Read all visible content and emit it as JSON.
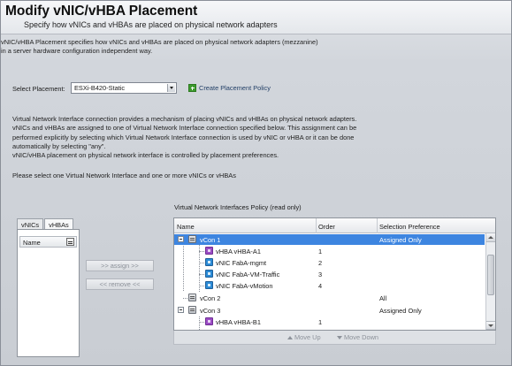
{
  "header": {
    "title": "Modify vNIC/vHBA Placement",
    "subtitle": "Specify how vNICs and vHBAs are placed on physical network adapters"
  },
  "intro": {
    "line1": "vNIC/vHBA Placement specifies how vNICs and vHBAs are placed on physical network adapters (mezzanine)",
    "line2": "in a server hardware configuration independent way."
  },
  "placement": {
    "label": "Select Placement:",
    "selected": "ESXi-B420-Static",
    "create_label": "Create Placement Policy"
  },
  "explanation": {
    "line1": "Virtual Network Interface connection provides a mechanism of placing vNICs and vHBAs on physical network adapters.",
    "line2": "vNICs and vHBAs are assigned to one of Virtual Network Interface connection specified below. This assignment can be",
    "line3": "performed explicitly by selecting which Virtual Network Interface connection is used by vNIC or vHBA or it can be done",
    "line4": "automatically by selecting \"any\".",
    "line5": "vNIC/vHBA placement on physical network interface is controlled by placement preferences.",
    "instruction": "Please select one Virtual Network Interface and one or more vNICs or vHBAs"
  },
  "left_panel": {
    "tabs": [
      {
        "label": "vNICs"
      },
      {
        "label": "vHBAs"
      }
    ],
    "column": "Name"
  },
  "buttons": {
    "assign": ">> assign >>",
    "remove": "<< remove <<"
  },
  "policy_table": {
    "label": "Virtual Network Interfaces Policy (read only)",
    "columns": [
      "Name",
      "Order",
      "Selection Preference"
    ],
    "rows": [
      {
        "name": "vCon 1",
        "order": "",
        "preference": "Assigned Only"
      },
      {
        "name": "vHBA vHBA-A1",
        "order": "1",
        "preference": ""
      },
      {
        "name": "vNIC FabA-mgmt",
        "order": "2",
        "preference": ""
      },
      {
        "name": "vNIC FabA-VM-Traffic",
        "order": "3",
        "preference": ""
      },
      {
        "name": "vNIC FabA-vMotion",
        "order": "4",
        "preference": ""
      },
      {
        "name": "vCon 2",
        "order": "",
        "preference": "All"
      },
      {
        "name": "vCon 3",
        "order": "",
        "preference": "Assigned Only"
      },
      {
        "name": "vHBA vHBA-B1",
        "order": "1",
        "preference": ""
      }
    ]
  },
  "actions": {
    "move_up": "Move Up",
    "move_down": "Move Down"
  }
}
